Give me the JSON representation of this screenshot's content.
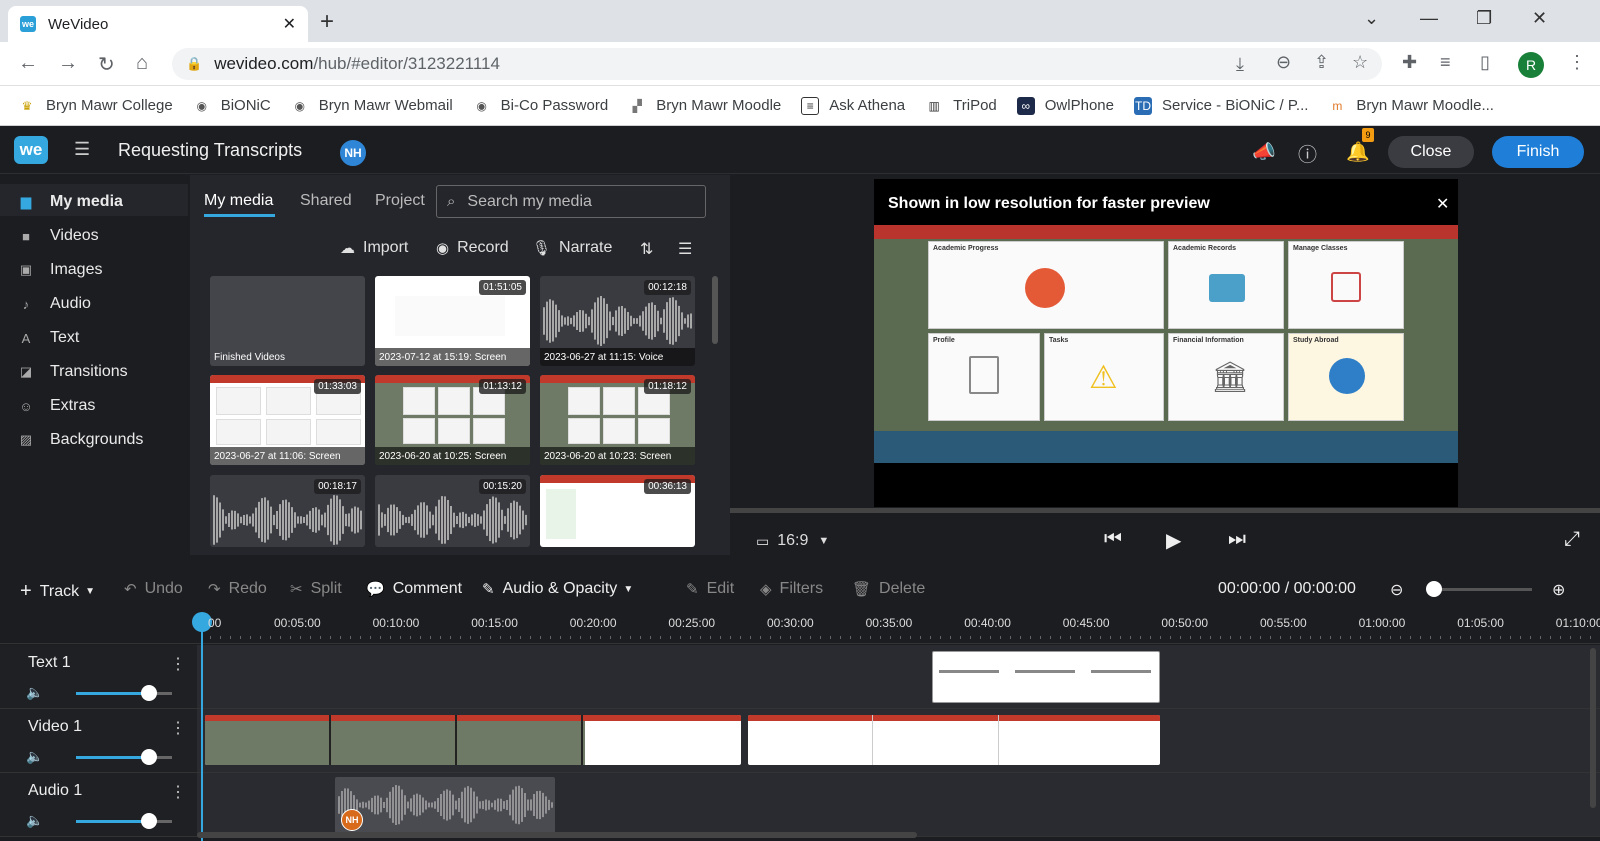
{
  "browser": {
    "tab_title": "WeVideo",
    "tab_close": "✕",
    "new_tab": "+",
    "url_domain": "wevideo.com",
    "url_path": "/hub/#editor/3123221114",
    "profile_initial": "R",
    "bookmarks": [
      {
        "label": "Bryn Mawr College"
      },
      {
        "label": "BiONiC"
      },
      {
        "label": "Bryn Mawr Webmail"
      },
      {
        "label": "Bi-Co Password"
      },
      {
        "label": "Bryn Mawr Moodle"
      },
      {
        "label": "Ask Athena"
      },
      {
        "label": "TriPod"
      },
      {
        "label": "OwlPhone"
      },
      {
        "label": "Service - BiONiC / P..."
      },
      {
        "label": "Bryn Mawr Moodle..."
      }
    ]
  },
  "app": {
    "logo": "we",
    "project_title": "Requesting Transcripts",
    "user_initials": "NH",
    "notif_count": "9",
    "close_label": "Close",
    "finish_label": "Finish"
  },
  "leftnav": {
    "items": [
      {
        "label": "My media",
        "icon": "folder-icon"
      },
      {
        "label": "Videos",
        "icon": "video-icon"
      },
      {
        "label": "Images",
        "icon": "image-icon"
      },
      {
        "label": "Audio",
        "icon": "music-icon"
      },
      {
        "label": "Text",
        "icon": "text-icon"
      },
      {
        "label": "Transitions",
        "icon": "transition-icon"
      },
      {
        "label": "Extras",
        "icon": "smiley-icon"
      },
      {
        "label": "Backgrounds",
        "icon": "background-icon"
      }
    ]
  },
  "media": {
    "tabs": [
      "My media",
      "Shared",
      "Project"
    ],
    "search_placeholder": "Search my media",
    "import_label": "Import",
    "record_label": "Record",
    "narrate_label": "Narrate",
    "thumbs": [
      {
        "caption": "Finished Videos",
        "duration": "",
        "kind": "folder"
      },
      {
        "caption": "2023-07-12 at 15:19: Screen",
        "duration": "01:51:05",
        "kind": "screen"
      },
      {
        "caption": "2023-06-27 at 11:15: Voice",
        "duration": "00:12:18",
        "kind": "wave"
      },
      {
        "caption": "2023-06-27 at 11:06: Screen",
        "duration": "01:33:03",
        "kind": "screen"
      },
      {
        "caption": "2023-06-20 at 10:25: Screen",
        "duration": "01:13:12",
        "kind": "screen"
      },
      {
        "caption": "2023-06-20 at 10:23: Screen",
        "duration": "01:18:12",
        "kind": "screen"
      },
      {
        "caption": "",
        "duration": "00:18:17",
        "kind": "wave"
      },
      {
        "caption": "",
        "duration": "00:15:20",
        "kind": "wave"
      },
      {
        "caption": "",
        "duration": "00:36:13",
        "kind": "screen"
      }
    ]
  },
  "preview": {
    "message": "Shown in low resolution for faster preview",
    "close": "✕",
    "aspect": "16:9",
    "cards": [
      {
        "title": "Academic Progress"
      },
      {
        "title": "Academic Records"
      },
      {
        "title": "Manage Classes"
      },
      {
        "title": "Profile"
      },
      {
        "title": "Tasks"
      },
      {
        "title": "Financial Information"
      },
      {
        "title": "Study Abroad"
      }
    ]
  },
  "toolbar": {
    "track_label": "Track",
    "undo_label": "Undo",
    "redo_label": "Redo",
    "split_label": "Split",
    "comment_label": "Comment",
    "audio_opacity_label": "Audio & Opacity",
    "edit_label": "Edit",
    "filters_label": "Filters",
    "delete_label": "Delete",
    "timecode": "00:00:00 / 00:00:00"
  },
  "ruler": {
    "labels": [
      "00",
      "00:05:00",
      "00:10:00",
      "00:15:00",
      "00:20:00",
      "00:25:00",
      "00:30:00",
      "00:35:00",
      "00:40:00",
      "00:45:00",
      "00:50:00",
      "00:55:00",
      "01:00:00",
      "01:05:00",
      "01:10:00"
    ]
  },
  "tracks": [
    {
      "name": "Text 1",
      "volume": 0.75
    },
    {
      "name": "Video 1",
      "volume": 0.75
    },
    {
      "name": "Audio 1",
      "volume": 0.75
    }
  ],
  "audio_clip_initials": "NH"
}
